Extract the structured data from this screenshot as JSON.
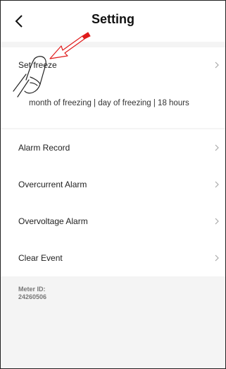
{
  "header": {
    "title": "Setting",
    "back_icon": "chevron-left-icon"
  },
  "freeze": {
    "label": "Set freeze",
    "description": "month of freezing | day of freezing | 18 hours",
    "chevron_icon": "chevron-right-icon"
  },
  "menu": {
    "items": [
      {
        "label": "Alarm Record"
      },
      {
        "label": "Overcurrent Alarm"
      },
      {
        "label": "Overvoltage Alarm"
      },
      {
        "label": "Clear Event"
      }
    ]
  },
  "meter": {
    "label": "Meter ID:",
    "value": "24260506"
  },
  "annotation": {
    "pointer_icon": "hand-pointer-icon",
    "arrow_color": "#e01b1b"
  }
}
